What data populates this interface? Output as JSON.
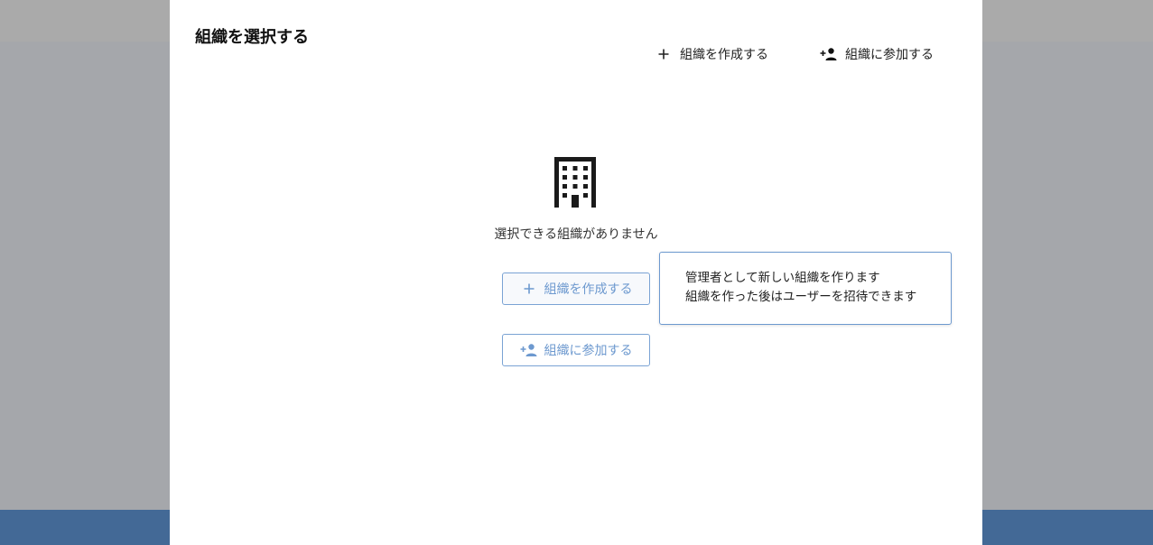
{
  "dialog": {
    "title": "組織を選択する",
    "header_actions": {
      "create": {
        "label": "組織を作成する",
        "icon": "plus-icon"
      },
      "join": {
        "label": "組織に参加する",
        "icon": "person-add-icon"
      }
    }
  },
  "empty_state": {
    "icon": "building-icon",
    "message": "選択できる組織がありません",
    "create_button": {
      "label": "組織を作成する",
      "icon": "plus-icon"
    },
    "join_button": {
      "label": "組織に参加する",
      "icon": "person-add-icon"
    }
  },
  "tooltip": {
    "line1": "管理者として新しい組織を作ります",
    "line2": "組織を作った後はユーザーを招待できます"
  },
  "colors": {
    "backdrop": "#a5a7ab",
    "bottom_bar": "#436996",
    "accent": "#6d99cf",
    "accent_border": "#7aa3d4"
  }
}
